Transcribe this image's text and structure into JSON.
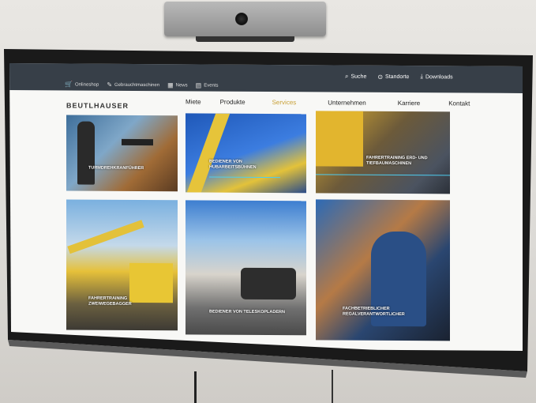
{
  "topbar": {
    "left_items": [
      {
        "label": "Onlineshop",
        "icon": "cart-icon"
      },
      {
        "label": "Gebrauchtmaschinen",
        "icon": "wrench-icon"
      },
      {
        "label": "News",
        "icon": "newspaper-icon"
      },
      {
        "label": "Events",
        "icon": "calendar-icon"
      }
    ],
    "right_items": [
      {
        "label": "Suche",
        "icon": "search-icon"
      },
      {
        "label": "Standorte",
        "icon": "location-pin-icon"
      },
      {
        "label": "Downloads",
        "icon": "download-icon"
      }
    ]
  },
  "brand": {
    "logo": "BEUTLHAUSER"
  },
  "nav": {
    "links": [
      "Miete",
      "Produkte",
      "Services",
      "Unternehmen",
      "Karriere",
      "Kontakt"
    ],
    "active": "Services",
    "active_color": "#c9a23a"
  },
  "tiles": [
    {
      "label": "TURMDREHKRANFÜHRER"
    },
    {
      "label": "BEDIENER VON\nHUBARBEITSBÜHNEN"
    },
    {
      "label": "FAHRERTRAINING ERD- UND\nTIEFBAUMASCHINEN"
    },
    {
      "label": "FAHRERTRAINING\nZWEIWEGEBAGGER"
    },
    {
      "label": "BEDIENER VON TELESKOPLADERN"
    },
    {
      "label": "FACHBETRIEBLICHER\nREGALVERANTWORTLICHER"
    }
  ],
  "colors": {
    "topbar": "#373f48",
    "underline": "#4ecdf0",
    "accent": "#c9a23a"
  }
}
